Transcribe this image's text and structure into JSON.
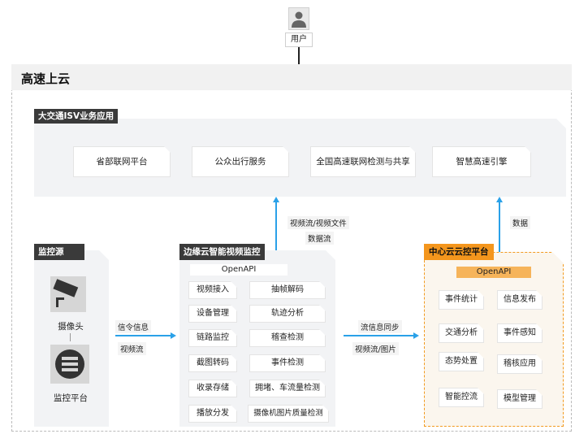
{
  "user": {
    "label": "用户"
  },
  "cloud": {
    "title": "高速上云"
  },
  "app_layer": {
    "title": "大交通ISV业务应用",
    "apps": [
      "省部联网平台",
      "公众出行服务",
      "全国高速联网检测与共享",
      "智慧高速引擎"
    ]
  },
  "source": {
    "title": "监控源",
    "camera_label": "摄像头",
    "platform_label": "监控平台"
  },
  "edge": {
    "title": "边缘云智能视频监控",
    "openapi": "OpenAPI",
    "left_items": [
      "视频接入",
      "设备管理",
      "链路监控",
      "截图转码",
      "收录存储",
      "播放分发"
    ],
    "right_items": [
      "抽帧解码",
      "轨迹分析",
      "稽查检测",
      "事件检测",
      "拥堵、车流量检测",
      "摄像机图片质量检测"
    ]
  },
  "center": {
    "title": "中心云云控平台",
    "openapi": "OpenAPI",
    "left_items": [
      "事件统计",
      "交通分析",
      "态势处置",
      "智能控流"
    ],
    "right_items": [
      "信息发布",
      "事件感知",
      "稽核应用",
      "模型管理"
    ]
  },
  "flows": {
    "src_to_edge": [
      "信令信息",
      "视频流"
    ],
    "edge_to_center": [
      "流信息同步",
      "视频流/图片"
    ],
    "edge_to_app": [
      "视频流/视频文件",
      "数据流"
    ],
    "center_to_app": [
      "数据"
    ]
  },
  "colors": {
    "accent_blue": "#2aa1e8",
    "accent_orange": "#f4961d",
    "dark_label": "#3a3a3a"
  },
  "icons": [
    "user-icon",
    "camera-icon",
    "server-icon"
  ]
}
